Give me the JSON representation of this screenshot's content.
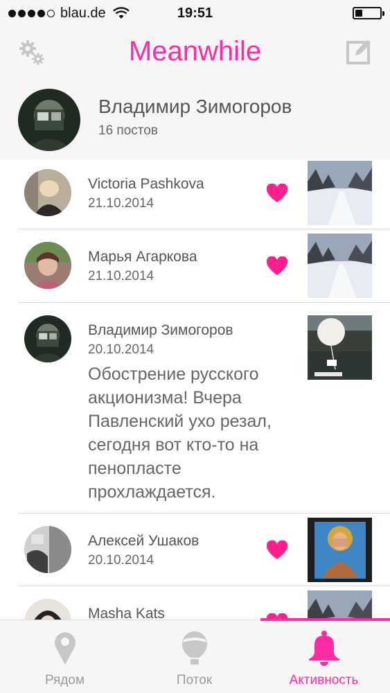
{
  "status_bar": {
    "carrier": "blau.de",
    "time": "19:51",
    "battery_level": 0.3
  },
  "nav": {
    "title": "Meanwhile",
    "accent_color": "#ff2ba5"
  },
  "profile": {
    "name": "Владимир Зимогоров",
    "posts_count": "16 постов"
  },
  "feed": {
    "items": [
      {
        "name": "Victoria Pashkova",
        "date": "21.10.2014",
        "liked": true
      },
      {
        "name": "Марья Агаркова",
        "date": "21.10.2014",
        "liked": true
      },
      {
        "name": "Владимир Зимогоров",
        "date": "20.10.2014",
        "text": "Обострение русского акционизма! Вчера Павленский ухо резал, сегодня вот кто-то на пенопласте прохлаждается."
      },
      {
        "name": "Алексей Ушаков",
        "date": "20.10.2014",
        "liked": true
      },
      {
        "name": "Masha Kats",
        "date": "",
        "liked": true
      }
    ]
  },
  "tabs": [
    {
      "label": "Рядом",
      "icon": "map-pin-icon"
    },
    {
      "label": "Поток",
      "icon": "balloon-icon"
    },
    {
      "label": "Активность",
      "icon": "bell-icon",
      "active": true
    }
  ]
}
